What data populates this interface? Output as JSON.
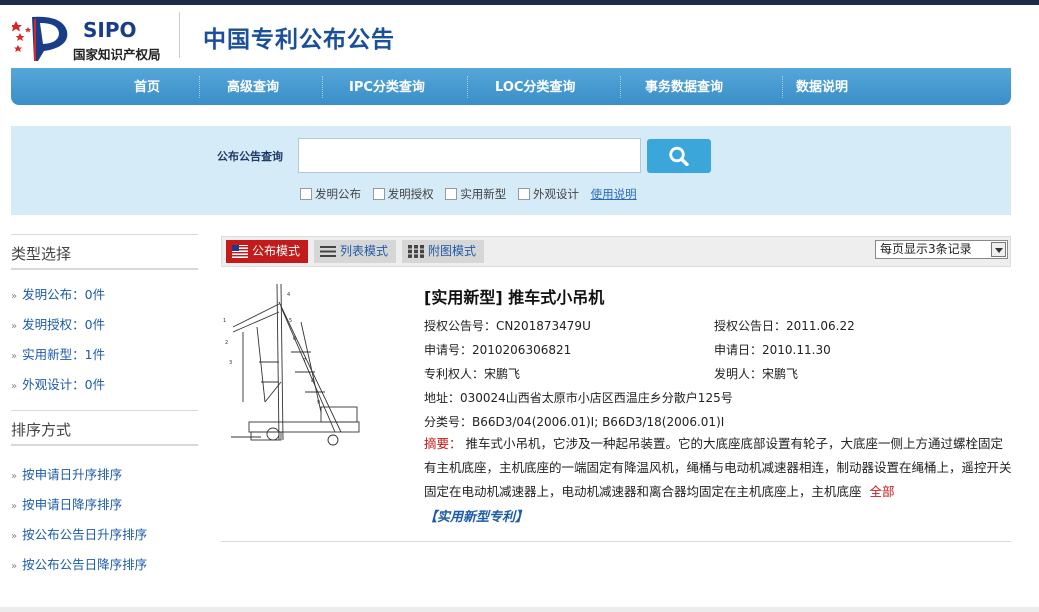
{
  "header": {
    "logo_sipo": "SIPO",
    "logo_cn": "国家知识产权局",
    "site_title": "中国专利公布公告"
  },
  "nav": {
    "items": [
      "首页",
      "高级查询",
      "IPC分类查询",
      "LOC分类查询",
      "事务数据查询",
      "数据说明"
    ]
  },
  "search": {
    "label": "公布公告查询",
    "value": "",
    "placeholder": "",
    "checkboxes": [
      "发明公布",
      "发明授权",
      "实用新型",
      "外观设计"
    ],
    "usage_link": "使用说明"
  },
  "sidebar": {
    "type_heading": "类型选择",
    "type_items": [
      "发明公布：0件",
      "发明授权：0件",
      "实用新型：1件",
      "外观设计：0件"
    ],
    "sort_heading": "排序方式",
    "sort_items": [
      "按申请日升序排序",
      "按申请日降序排序",
      "按公布公告日升序排序",
      "按公布公告日降序排序"
    ]
  },
  "toolbar": {
    "modes": [
      "公布模式",
      "列表模式",
      "附图模式"
    ],
    "active_mode": "公布模式",
    "per_page": "每页显示3条记录"
  },
  "result": {
    "title": "[实用新型] 推车式小吊机",
    "grant_no": "授权公告号：CN201873479U",
    "grant_date": "授权公告日：2011.06.22",
    "app_no": "申请号：2010206306821",
    "app_date": "申请日：2010.11.30",
    "patentee": "专利权人：宋鹏飞",
    "inventor": "发明人：宋鹏飞",
    "address": "地址：030024山西省太原市小店区西温庄乡分散户125号",
    "classification": "分类号：B66D3/04(2006.01)I;  B66D3/18(2006.01)I",
    "abstract_label": "摘要：",
    "abstract": "推车式小吊机，它涉及一种起吊装置。它的大底座底部设置有轮子，大底座一侧上方通过螺栓固定有主机底座，主机底座的一端固定有降温风机，绳桶与电动机减速器相连，制动器设置在绳桶上，遥控开关固定在电动机减速器上，电动机减速器和离合器均固定在主机底座上，主机底座",
    "more": "全部",
    "type_link": "【实用新型专利】"
  },
  "colors": {
    "nav_blue": "#3b8ec8",
    "active_red": "#c31b1b",
    "link_blue": "#1c5ba8",
    "search_bg": "#d6ebf8"
  }
}
